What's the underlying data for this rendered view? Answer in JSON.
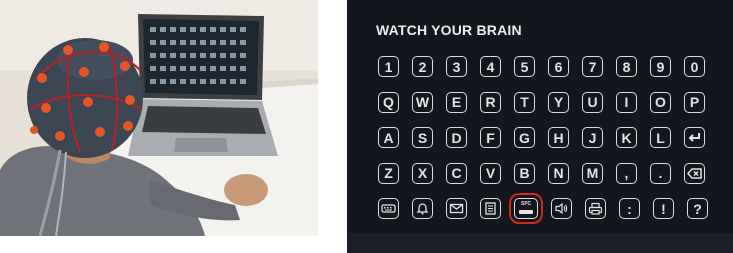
{
  "photo": {
    "description_icon": "person-wearing-eeg-cap-at-laptop"
  },
  "speller": {
    "title": "WATCH YOUR BRAIN",
    "rows": [
      [
        {
          "label": "1"
        },
        {
          "label": "2"
        },
        {
          "label": "3"
        },
        {
          "label": "4"
        },
        {
          "label": "5"
        },
        {
          "label": "6"
        },
        {
          "label": "7"
        },
        {
          "label": "8"
        },
        {
          "label": "9"
        },
        {
          "label": "0"
        }
      ],
      [
        {
          "label": "Q"
        },
        {
          "label": "W"
        },
        {
          "label": "E"
        },
        {
          "label": "R"
        },
        {
          "label": "T"
        },
        {
          "label": "Y"
        },
        {
          "label": "U"
        },
        {
          "label": "I"
        },
        {
          "label": "O"
        },
        {
          "label": "P"
        }
      ],
      [
        {
          "label": "A"
        },
        {
          "label": "S"
        },
        {
          "label": "D"
        },
        {
          "label": "F"
        },
        {
          "label": "G"
        },
        {
          "label": "H"
        },
        {
          "label": "J"
        },
        {
          "label": "K"
        },
        {
          "label": "L"
        },
        {
          "icon": "enter-icon"
        }
      ],
      [
        {
          "label": "Z"
        },
        {
          "label": "X"
        },
        {
          "label": "C"
        },
        {
          "label": "V"
        },
        {
          "label": "B"
        },
        {
          "label": "N"
        },
        {
          "label": "M"
        },
        {
          "label": ","
        },
        {
          "label": "."
        },
        {
          "icon": "backspace-icon"
        }
      ],
      [
        {
          "icon": "keyboard-icon"
        },
        {
          "icon": "bell-icon"
        },
        {
          "icon": "mail-icon"
        },
        {
          "icon": "document-icon"
        },
        {
          "icon": "space-icon",
          "label": "SPC",
          "selected": true
        },
        {
          "icon": "speaker-icon"
        },
        {
          "icon": "print-icon"
        },
        {
          "label": ":"
        },
        {
          "label": "!"
        },
        {
          "label": "?"
        }
      ]
    ],
    "colors": {
      "background": "#12171d",
      "key_border": "#d8dde1",
      "selection": "#d0281c"
    }
  }
}
